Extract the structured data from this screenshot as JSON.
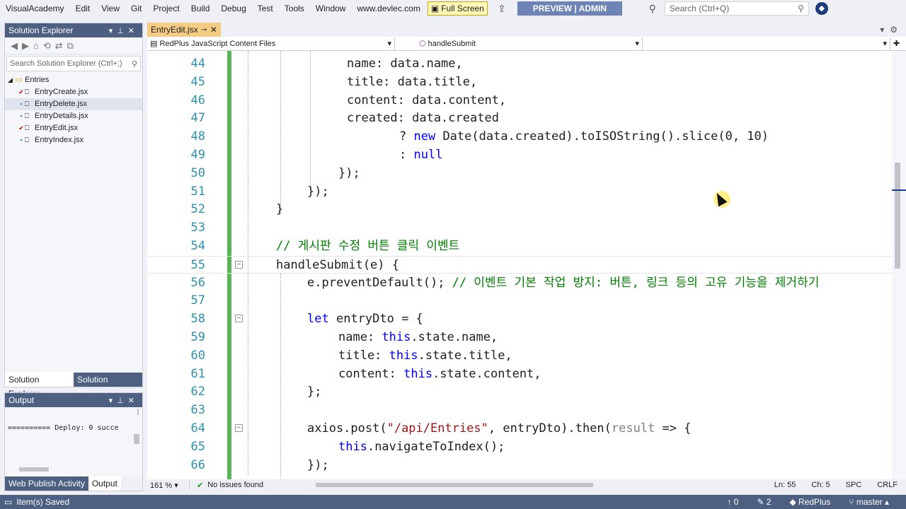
{
  "menu": {
    "items": [
      "VisualAcademy",
      "Edit",
      "View",
      "Git",
      "Project",
      "Build",
      "Debug",
      "Test",
      "Tools",
      "Window",
      "www.devlec.com"
    ],
    "fullscreen_label": "Full Screen",
    "preview_label": "PREVIEW | ADMIN",
    "search_placeholder": "Search (Ctrl+Q)"
  },
  "solution_explorer": {
    "title": "Solution Explorer",
    "search_placeholder": "Search Solution Explorer (Ctrl+;)",
    "folder": "Entries",
    "files": [
      {
        "name": "EntryCreate.jsx",
        "modified": true,
        "selected": false
      },
      {
        "name": "EntryDelete.jsx",
        "modified": false,
        "selected": true
      },
      {
        "name": "EntryDetails.jsx",
        "modified": false,
        "selected": false
      },
      {
        "name": "EntryEdit.jsx",
        "modified": true,
        "selected": false
      },
      {
        "name": "EntryIndex.jsx",
        "modified": false,
        "selected": false
      }
    ],
    "tabs": [
      "Solution Explorer",
      "Solution Explorer"
    ]
  },
  "output_panel": {
    "title": "Output",
    "text": "========== Deploy: 0 succe",
    "tabs": [
      "Web Publish Activity",
      "Output"
    ]
  },
  "editor": {
    "tab_label": "EntryEdit.jsx",
    "project_dropdown": "RedPlus JavaScript Content Files",
    "member_dropdown": "handleSubmit",
    "lines": [
      {
        "n": "44",
        "tokens": [
          [
            "",
            "name: data.name,"
          ]
        ]
      },
      {
        "n": "45",
        "tokens": [
          [
            "",
            "title: data.title,"
          ]
        ]
      },
      {
        "n": "46",
        "tokens": [
          [
            "",
            "content: data.content,"
          ]
        ]
      },
      {
        "n": "47",
        "tokens": [
          [
            "",
            "created: data.created"
          ]
        ]
      },
      {
        "n": "48",
        "tokens": [
          [
            "",
            "? "
          ],
          [
            "kw",
            "new"
          ],
          [
            "",
            " Date(data.created).toISOString().slice(0, 10)"
          ]
        ]
      },
      {
        "n": "49",
        "tokens": [
          [
            "",
            ": "
          ],
          [
            "kw",
            "null"
          ]
        ]
      },
      {
        "n": "50",
        "tokens": [
          [
            "",
            "});"
          ]
        ]
      },
      {
        "n": "51",
        "tokens": [
          [
            "",
            "});"
          ]
        ]
      },
      {
        "n": "52",
        "tokens": [
          [
            "",
            "}"
          ]
        ]
      },
      {
        "n": "53",
        "tokens": []
      },
      {
        "n": "54",
        "tokens": [
          [
            "cm",
            "// 게시판 수정 버튼 클릭 이벤트"
          ]
        ]
      },
      {
        "n": "55",
        "tokens": [
          [
            "",
            "handleSubmit(e) {"
          ]
        ]
      },
      {
        "n": "56",
        "tokens": [
          [
            "",
            "e.preventDefault(); "
          ],
          [
            "cm",
            "// 이벤트 기본 작업 방지: 버튼, 링크 등의 고유 기능을 제거하기"
          ]
        ]
      },
      {
        "n": "57",
        "tokens": []
      },
      {
        "n": "58",
        "tokens": [
          [
            "kw",
            "let"
          ],
          [
            "",
            " entryDto = {"
          ]
        ]
      },
      {
        "n": "59",
        "tokens": [
          [
            "",
            "name: "
          ],
          [
            "kw",
            "this"
          ],
          [
            "",
            ".state.name,"
          ]
        ]
      },
      {
        "n": "60",
        "tokens": [
          [
            "",
            "title: "
          ],
          [
            "kw",
            "this"
          ],
          [
            "",
            ".state.title,"
          ]
        ]
      },
      {
        "n": "61",
        "tokens": [
          [
            "",
            "content: "
          ],
          [
            "kw",
            "this"
          ],
          [
            "",
            ".state.content,"
          ]
        ]
      },
      {
        "n": "62",
        "tokens": [
          [
            "",
            "};"
          ]
        ]
      },
      {
        "n": "63",
        "tokens": []
      },
      {
        "n": "64",
        "tokens": [
          [
            "",
            "axios.post("
          ],
          [
            "st",
            "\"/api/Entries\""
          ],
          [
            "",
            ", entryDto).then("
          ],
          [
            "gy",
            "result"
          ],
          [
            "",
            " => {"
          ]
        ]
      },
      {
        "n": "65",
        "tokens": [
          [
            "kw",
            "this"
          ],
          [
            "",
            ".navigateToIndex();"
          ]
        ]
      },
      {
        "n": "66",
        "tokens": [
          [
            "",
            "});"
          ]
        ]
      }
    ],
    "zoom": "161 %",
    "issues": "No issues found",
    "ln": "Ln: 55",
    "ch": "Ch: 5",
    "spc": "SPC",
    "crlf": "CRLF"
  },
  "statusbar": {
    "left": "Item(s) Saved",
    "up_count": "↑ 0",
    "edit_count": "✎ 2",
    "repo": "RedPlus",
    "branch": "master"
  }
}
